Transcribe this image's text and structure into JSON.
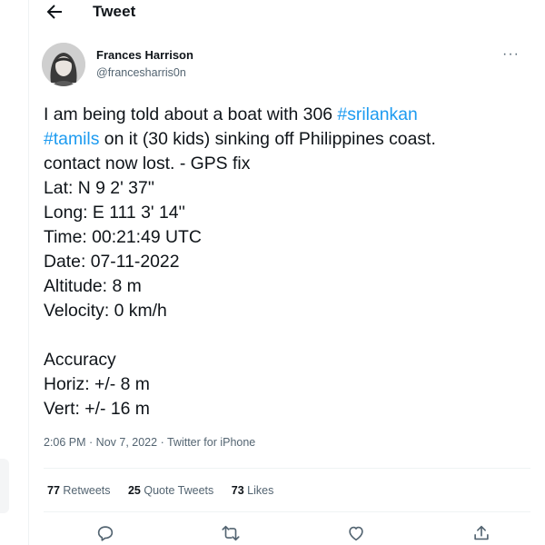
{
  "header": {
    "title": "Tweet",
    "back_icon": "arrow-left-icon"
  },
  "author": {
    "name": "Frances Harrison",
    "handle": "@francesharris0n",
    "avatar": "avatar-photo",
    "more_icon": "more-dots-icon",
    "more_label": "···"
  },
  "tweet": {
    "part1": "I am being told about a boat with 306 ",
    "hashtag1": "#srilankan",
    "hashtag2": "#tamils",
    "part2": " on it (30 kids) sinking off Philippines coast.",
    "line3": "contact now lost. - GPS fix",
    "line4": "Lat: N 9 2' 37''",
    "line5": "Long: E 111 3' 14''",
    "line6": "Time: 00:21:49 UTC",
    "line7": "Date: 07-11-2022",
    "line8": "Altitude: 8 m",
    "line9": "Velocity: 0 km/h",
    "line11": "Accuracy",
    "line12": "Horiz: +/- 8 m",
    "line13": "Vert: +/- 16 m"
  },
  "meta": {
    "time": "2:06 PM",
    "separator1": " · ",
    "date": "Nov 7, 2022",
    "separator2": " · ",
    "source": "Twitter for iPhone"
  },
  "stats": {
    "retweets_count": "77",
    "retweets_label": "Retweets",
    "quotes_count": "25",
    "quotes_label": "Quote Tweets",
    "likes_count": "73",
    "likes_label": "Likes"
  },
  "actions": [
    "reply-icon",
    "retweet-icon",
    "like-icon",
    "share-icon"
  ],
  "colors": {
    "link": "#1d9bf0",
    "text": "#0f1419",
    "secondary": "#536471",
    "divider": "#eff3f4"
  }
}
